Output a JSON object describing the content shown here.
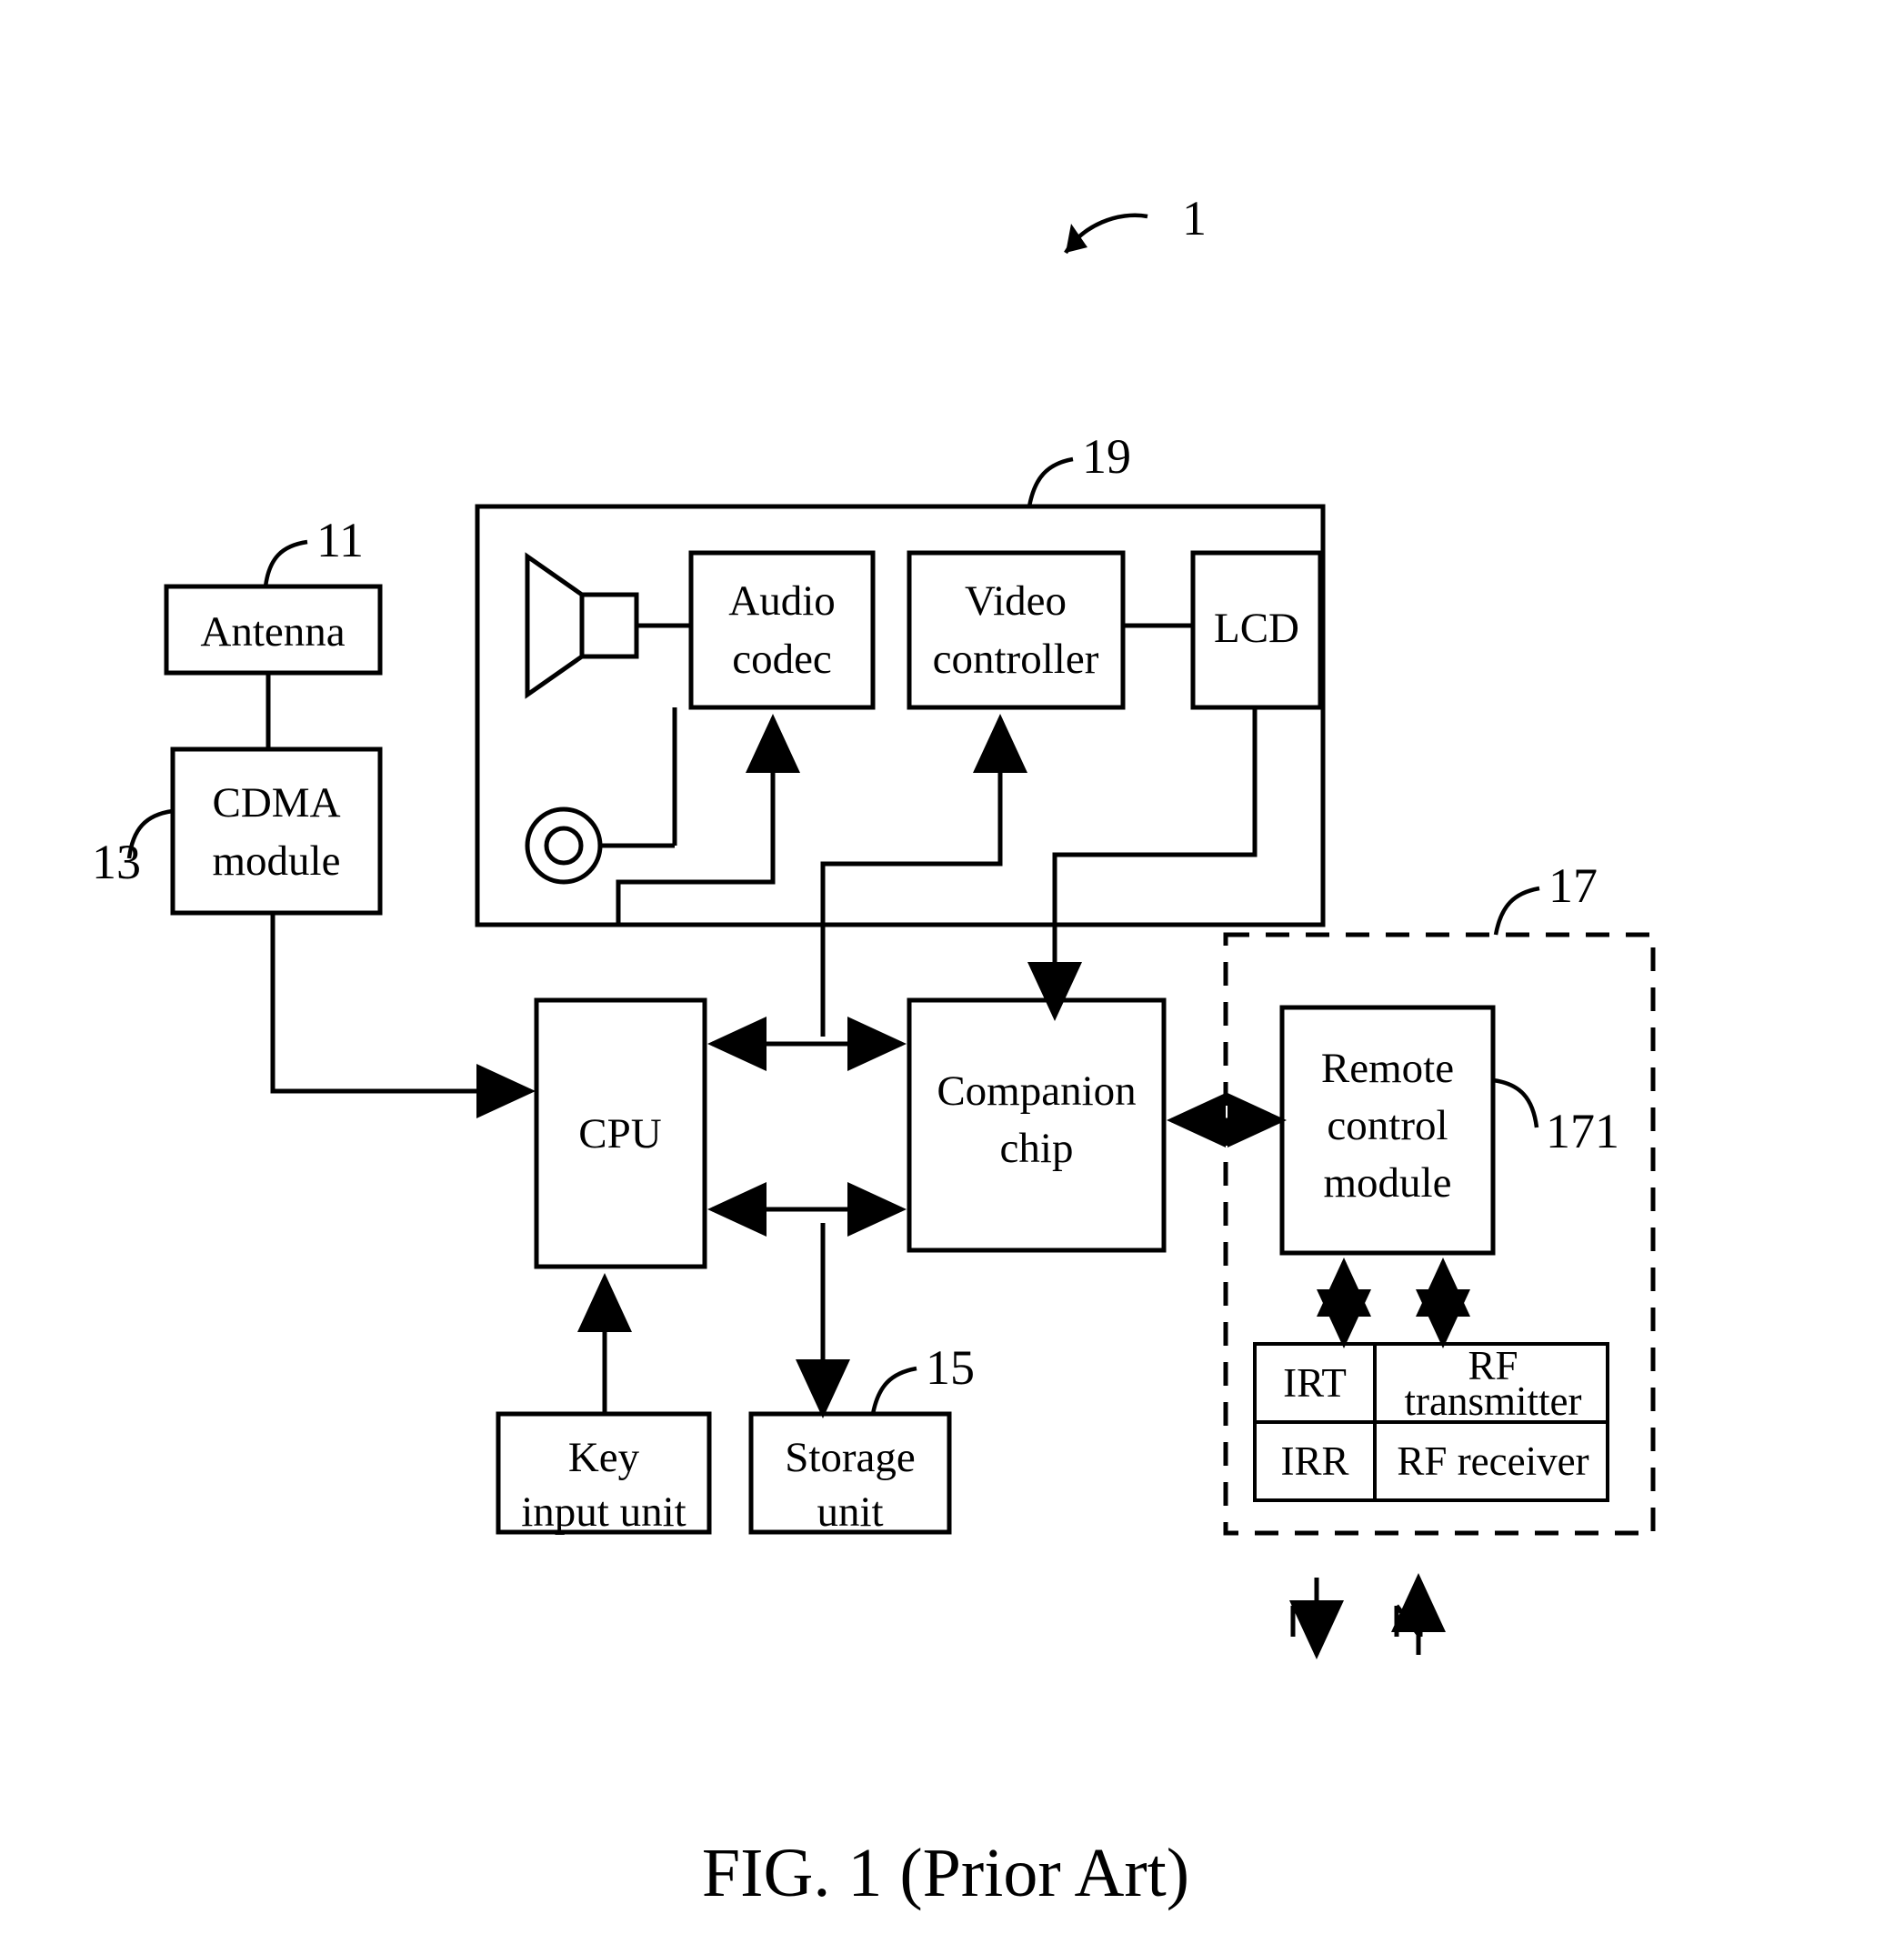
{
  "figure": {
    "caption": "FIG. 1 (Prior Art)",
    "system_label": "1"
  },
  "reference_numerals": {
    "system": "1",
    "antenna": "11",
    "cdma_module": "13",
    "storage_unit": "15",
    "remote_control_unit": "17",
    "remote_control_module": "171",
    "multimedia_block": "19"
  },
  "blocks": {
    "antenna": {
      "label": "Antenna",
      "ref": "11"
    },
    "cdma": {
      "line1": "CDMA",
      "line2": "module",
      "ref": "13"
    },
    "audio_codec": {
      "line1": "Audio",
      "line2": "codec"
    },
    "video_controller": {
      "line1": "Video",
      "line2": "controller"
    },
    "lcd": {
      "label": "LCD"
    },
    "cpu": {
      "label": "CPU"
    },
    "companion_chip": {
      "line1": "Companion",
      "line2": "chip"
    },
    "key_input_unit": {
      "line1": "Key",
      "line2": "input unit"
    },
    "storage_unit": {
      "line1": "Storage",
      "line2": "unit",
      "ref": "15"
    },
    "remote_control_module": {
      "line1": "Remote",
      "line2": "control",
      "line3": "module",
      "ref": "171"
    }
  },
  "transceiver_table": {
    "rows": [
      {
        "left": "IRT",
        "right_line1": "RF",
        "right_line2": "transmitter"
      },
      {
        "left": "IRR",
        "right_line1": "RF receiver",
        "right_line2": ""
      }
    ]
  },
  "icons": {
    "speaker": "speaker-icon",
    "microphone": "microphone-icon",
    "ir_out_signal": "ir-signal-out-arrow",
    "rf_in_signal": "rf-signal-in-arrow"
  },
  "colors": {
    "stroke": "#000000",
    "background": "#ffffff"
  }
}
